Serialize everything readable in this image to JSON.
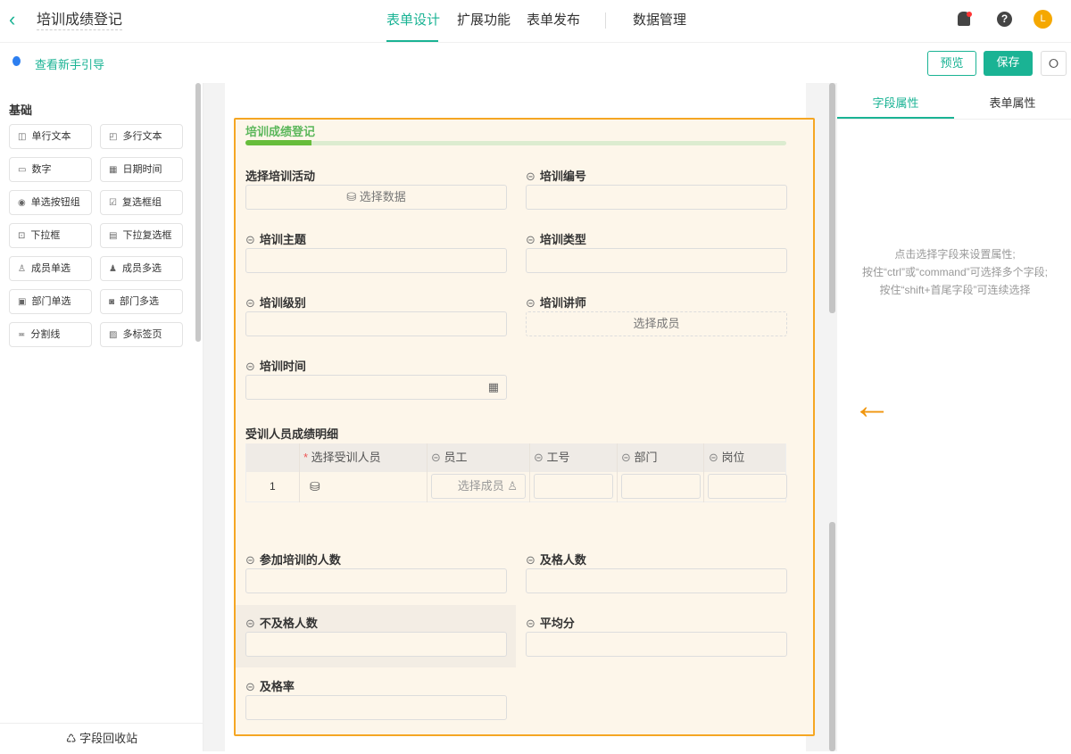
{
  "header": {
    "back_icon": "chevron-left-icon",
    "title": "培训成绩登记",
    "tabs": [
      {
        "label": "表单设计",
        "active": true
      },
      {
        "label": "扩展功能"
      },
      {
        "label": "表单发布"
      },
      {
        "label": "数据管理"
      }
    ],
    "avatar": "L"
  },
  "subbar": {
    "guide": "查看新手引导",
    "preview": "预览",
    "save": "保存"
  },
  "sidebar": {
    "group": "基础",
    "items": [
      {
        "label": "单行文本",
        "icon": "◫"
      },
      {
        "label": "多行文本",
        "icon": "◰"
      },
      {
        "label": "数字",
        "icon": "▭"
      },
      {
        "label": "日期时间",
        "icon": "▦"
      },
      {
        "label": "单选按钮组",
        "icon": "◉"
      },
      {
        "label": "复选框组",
        "icon": "☑"
      },
      {
        "label": "下拉框",
        "icon": "⊡"
      },
      {
        "label": "下拉复选框",
        "icon": "▤"
      },
      {
        "label": "成员单选",
        "icon": "♙"
      },
      {
        "label": "成员多选",
        "icon": "♟"
      },
      {
        "label": "部门单选",
        "icon": "▣"
      },
      {
        "label": "部门多选",
        "icon": "◙"
      },
      {
        "label": "分割线",
        "icon": "≖"
      },
      {
        "label": "多标签页",
        "icon": "▨"
      }
    ],
    "recycle": "字段回收站"
  },
  "form": {
    "title": "培训成绩登记",
    "fields": [
      {
        "label": "选择培训活动",
        "value": "选择数据",
        "linked": false
      },
      {
        "label": "培训编号",
        "value": "",
        "linked": true
      },
      {
        "label": "培训主题",
        "value": "",
        "linked": true
      },
      {
        "label": "培训类型",
        "value": "",
        "linked": true
      },
      {
        "label": "培训级别",
        "value": "",
        "linked": true
      },
      {
        "label": "培训讲师",
        "value": "选择成员",
        "linked": true
      },
      {
        "label": "培训时间",
        "value": "",
        "linked": true
      }
    ],
    "subtable": {
      "title": "受训人员成绩明细",
      "headers": [
        "选择受训人员",
        "员工",
        "工号",
        "部门",
        "岗位"
      ],
      "row_no": "1",
      "member_placeholder": "选择成员"
    },
    "fields2": [
      {
        "label": "参加培训的人数"
      },
      {
        "label": "及格人数"
      },
      {
        "label": "不及格人数"
      },
      {
        "label": "平均分"
      },
      {
        "label": "及格率"
      }
    ]
  },
  "panel": {
    "tabs": [
      "字段属性",
      "表单属性"
    ],
    "hint": [
      "点击选择字段来设置属性;",
      "按住“ctrl”或“command”可选择多个字段;",
      "按住“shift+首尾字段”可连续选择"
    ]
  }
}
